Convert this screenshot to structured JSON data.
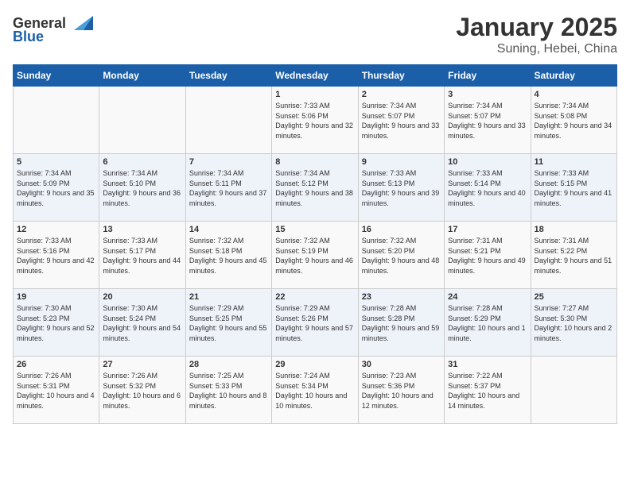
{
  "header": {
    "logo_general": "General",
    "logo_blue": "Blue",
    "month": "January 2025",
    "location": "Suning, Hebei, China"
  },
  "weekdays": [
    "Sunday",
    "Monday",
    "Tuesday",
    "Wednesday",
    "Thursday",
    "Friday",
    "Saturday"
  ],
  "weeks": [
    [
      {
        "day": "",
        "info": ""
      },
      {
        "day": "",
        "info": ""
      },
      {
        "day": "",
        "info": ""
      },
      {
        "day": "1",
        "info": "Sunrise: 7:33 AM\nSunset: 5:06 PM\nDaylight: 9 hours and 32 minutes."
      },
      {
        "day": "2",
        "info": "Sunrise: 7:34 AM\nSunset: 5:07 PM\nDaylight: 9 hours and 33 minutes."
      },
      {
        "day": "3",
        "info": "Sunrise: 7:34 AM\nSunset: 5:07 PM\nDaylight: 9 hours and 33 minutes."
      },
      {
        "day": "4",
        "info": "Sunrise: 7:34 AM\nSunset: 5:08 PM\nDaylight: 9 hours and 34 minutes."
      }
    ],
    [
      {
        "day": "5",
        "info": "Sunrise: 7:34 AM\nSunset: 5:09 PM\nDaylight: 9 hours and 35 minutes."
      },
      {
        "day": "6",
        "info": "Sunrise: 7:34 AM\nSunset: 5:10 PM\nDaylight: 9 hours and 36 minutes."
      },
      {
        "day": "7",
        "info": "Sunrise: 7:34 AM\nSunset: 5:11 PM\nDaylight: 9 hours and 37 minutes."
      },
      {
        "day": "8",
        "info": "Sunrise: 7:34 AM\nSunset: 5:12 PM\nDaylight: 9 hours and 38 minutes."
      },
      {
        "day": "9",
        "info": "Sunrise: 7:33 AM\nSunset: 5:13 PM\nDaylight: 9 hours and 39 minutes."
      },
      {
        "day": "10",
        "info": "Sunrise: 7:33 AM\nSunset: 5:14 PM\nDaylight: 9 hours and 40 minutes."
      },
      {
        "day": "11",
        "info": "Sunrise: 7:33 AM\nSunset: 5:15 PM\nDaylight: 9 hours and 41 minutes."
      }
    ],
    [
      {
        "day": "12",
        "info": "Sunrise: 7:33 AM\nSunset: 5:16 PM\nDaylight: 9 hours and 42 minutes."
      },
      {
        "day": "13",
        "info": "Sunrise: 7:33 AM\nSunset: 5:17 PM\nDaylight: 9 hours and 44 minutes."
      },
      {
        "day": "14",
        "info": "Sunrise: 7:32 AM\nSunset: 5:18 PM\nDaylight: 9 hours and 45 minutes."
      },
      {
        "day": "15",
        "info": "Sunrise: 7:32 AM\nSunset: 5:19 PM\nDaylight: 9 hours and 46 minutes."
      },
      {
        "day": "16",
        "info": "Sunrise: 7:32 AM\nSunset: 5:20 PM\nDaylight: 9 hours and 48 minutes."
      },
      {
        "day": "17",
        "info": "Sunrise: 7:31 AM\nSunset: 5:21 PM\nDaylight: 9 hours and 49 minutes."
      },
      {
        "day": "18",
        "info": "Sunrise: 7:31 AM\nSunset: 5:22 PM\nDaylight: 9 hours and 51 minutes."
      }
    ],
    [
      {
        "day": "19",
        "info": "Sunrise: 7:30 AM\nSunset: 5:23 PM\nDaylight: 9 hours and 52 minutes."
      },
      {
        "day": "20",
        "info": "Sunrise: 7:30 AM\nSunset: 5:24 PM\nDaylight: 9 hours and 54 minutes."
      },
      {
        "day": "21",
        "info": "Sunrise: 7:29 AM\nSunset: 5:25 PM\nDaylight: 9 hours and 55 minutes."
      },
      {
        "day": "22",
        "info": "Sunrise: 7:29 AM\nSunset: 5:26 PM\nDaylight: 9 hours and 57 minutes."
      },
      {
        "day": "23",
        "info": "Sunrise: 7:28 AM\nSunset: 5:28 PM\nDaylight: 9 hours and 59 minutes."
      },
      {
        "day": "24",
        "info": "Sunrise: 7:28 AM\nSunset: 5:29 PM\nDaylight: 10 hours and 1 minute."
      },
      {
        "day": "25",
        "info": "Sunrise: 7:27 AM\nSunset: 5:30 PM\nDaylight: 10 hours and 2 minutes."
      }
    ],
    [
      {
        "day": "26",
        "info": "Sunrise: 7:26 AM\nSunset: 5:31 PM\nDaylight: 10 hours and 4 minutes."
      },
      {
        "day": "27",
        "info": "Sunrise: 7:26 AM\nSunset: 5:32 PM\nDaylight: 10 hours and 6 minutes."
      },
      {
        "day": "28",
        "info": "Sunrise: 7:25 AM\nSunset: 5:33 PM\nDaylight: 10 hours and 8 minutes."
      },
      {
        "day": "29",
        "info": "Sunrise: 7:24 AM\nSunset: 5:34 PM\nDaylight: 10 hours and 10 minutes."
      },
      {
        "day": "30",
        "info": "Sunrise: 7:23 AM\nSunset: 5:36 PM\nDaylight: 10 hours and 12 minutes."
      },
      {
        "day": "31",
        "info": "Sunrise: 7:22 AM\nSunset: 5:37 PM\nDaylight: 10 hours and 14 minutes."
      },
      {
        "day": "",
        "info": ""
      }
    ]
  ]
}
